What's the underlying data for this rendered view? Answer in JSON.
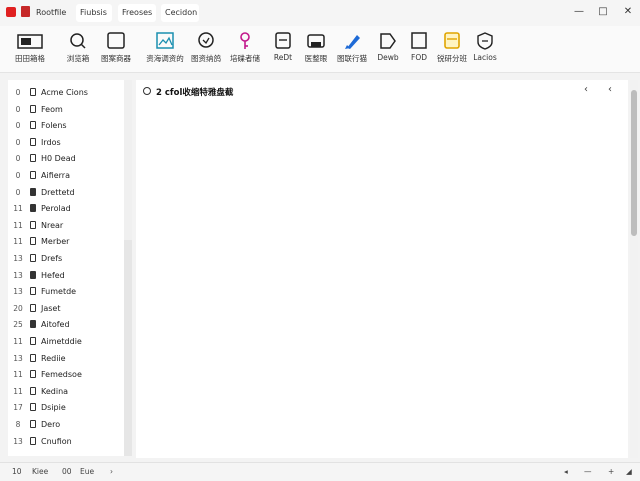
{
  "titlebar": {
    "tabs": [
      {
        "label": "Rootfile"
      },
      {
        "label": "Fiubsis"
      },
      {
        "label": "Freoses"
      },
      {
        "label": "Cecidon"
      }
    ],
    "controls": {
      "minimize": "—",
      "maximize": "□",
      "close": "✕"
    }
  },
  "ribbon": {
    "tools": [
      {
        "label": "田田箱格",
        "icon": "window-panel-icon"
      },
      {
        "label": "浏览箱",
        "icon": "search-icon"
      },
      {
        "label": "图案商器",
        "icon": "square-frame-icon"
      },
      {
        "label": "资海调资的",
        "icon": "image-icon"
      },
      {
        "label": "图资纳鸽",
        "icon": "feedback-icon"
      },
      {
        "label": "培碟者储",
        "icon": "key-icon"
      },
      {
        "label": "ReDt",
        "icon": "edit-box-icon"
      },
      {
        "label": "医整眼",
        "icon": "printer-icon"
      },
      {
        "label": "图联行猫",
        "icon": "brush-pen-icon"
      },
      {
        "label": "Dewb",
        "icon": "tag-icon"
      },
      {
        "label": "FOD",
        "icon": "page-icon"
      },
      {
        "label": "锐研分班",
        "icon": "calendar-icon"
      },
      {
        "label": "Lacios",
        "icon": "shield-icon"
      }
    ]
  },
  "sidebar": {
    "items": [
      {
        "num": "0",
        "label": "Acme Cions",
        "filled": false
      },
      {
        "num": "0",
        "label": "Feom",
        "filled": false
      },
      {
        "num": "0",
        "label": "Folens",
        "filled": false
      },
      {
        "num": "0",
        "label": "Irdos",
        "filled": false
      },
      {
        "num": "0",
        "label": "H0 Dead",
        "filled": false
      },
      {
        "num": "0",
        "label": "Aifierra",
        "filled": false
      },
      {
        "num": "0",
        "label": "Drettetd",
        "filled": true
      },
      {
        "num": "11",
        "label": "Perolad",
        "filled": true
      },
      {
        "num": "11",
        "label": "Nrear",
        "filled": false
      },
      {
        "num": "11",
        "label": "Merber",
        "filled": false
      },
      {
        "num": "13",
        "label": "Drefs",
        "filled": false
      },
      {
        "num": "13",
        "label": "Hefed",
        "filled": true
      },
      {
        "num": "13",
        "label": "Fumetde",
        "filled": false
      },
      {
        "num": "20",
        "label": "Jaset",
        "filled": false
      },
      {
        "num": "25",
        "label": "Aitofed",
        "filled": true
      },
      {
        "num": "11",
        "label": "Aimetddie",
        "filled": false
      },
      {
        "num": "13",
        "label": "Rediie",
        "filled": false
      },
      {
        "num": "11",
        "label": "Femedsoe",
        "filled": false
      },
      {
        "num": "11",
        "label": "Kedina",
        "filled": false
      },
      {
        "num": "17",
        "label": "Dsipie",
        "filled": false
      },
      {
        "num": "8",
        "label": "Dero",
        "filled": false
      },
      {
        "num": "13",
        "label": "Cnufion",
        "filled": false
      }
    ]
  },
  "main": {
    "title": "2 cfol收缩特雅盘截",
    "back_arrow": "‹",
    "forward_arrow": "‹"
  },
  "status": {
    "left1_num": "10",
    "left1_label": "Kiee",
    "left2_num": "00",
    "left2_label": "Eue",
    "left_arrow": "›",
    "right_left_arrow": "◂",
    "zoom_minus": "—",
    "zoom_plus": "+",
    "resize": "◢"
  }
}
